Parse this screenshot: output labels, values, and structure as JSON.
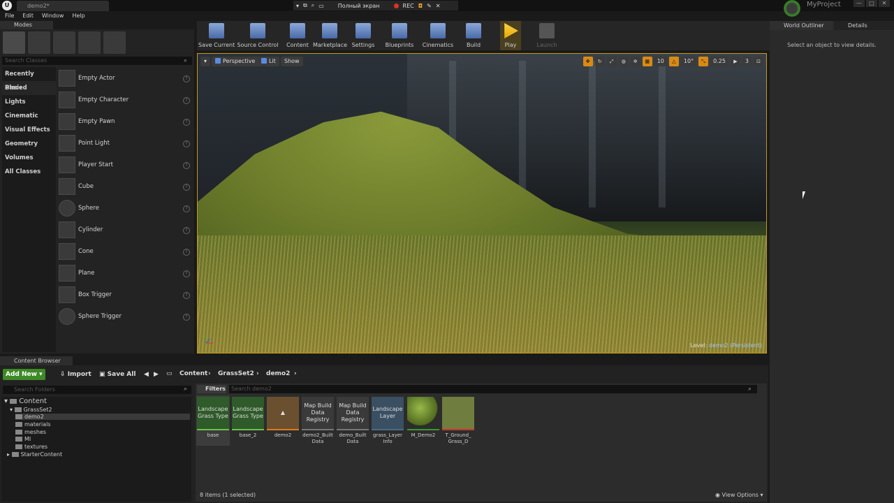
{
  "window": {
    "doc_tab": "demo2*",
    "project_name": "MyProject",
    "recorder": {
      "fullscreen_label": "Полный экран",
      "rec_label": "REC"
    }
  },
  "menu": [
    "File",
    "Edit",
    "Window",
    "Help"
  ],
  "modes": {
    "tab_label": "Modes",
    "search_placeholder": "Search Classes",
    "categories": [
      "Recently Placed",
      "Basic",
      "Lights",
      "Cinematic",
      "Visual Effects",
      "Geometry",
      "Volumes",
      "All Classes"
    ],
    "active_category": "Basic",
    "actors": [
      "Empty Actor",
      "Empty Character",
      "Empty Pawn",
      "Point Light",
      "Player Start",
      "Cube",
      "Sphere",
      "Cylinder",
      "Cone",
      "Plane",
      "Box Trigger",
      "Sphere Trigger"
    ]
  },
  "toolbar": {
    "buttons": [
      "Save Current",
      "Source Control",
      "Content",
      "Marketplace",
      "Settings",
      "Blueprints",
      "Cinematics",
      "Build",
      "Play",
      "Launch"
    ]
  },
  "viewport": {
    "perspective": "Perspective",
    "lit": "Lit",
    "show": "Show",
    "grid_snap": "10",
    "rot_snap": "10°",
    "scale_snap": "0.25",
    "camera_speed": "3",
    "level_label": "Level:",
    "level_value": "demo2 (Persistent)"
  },
  "right_panel": {
    "outliner_tab": "World Outliner",
    "details_tab": "Details",
    "details_message": "Select an object to view details."
  },
  "content_browser": {
    "tab_label": "Content Browser",
    "add_new": "Add New",
    "import": "Import",
    "save_all": "Save All",
    "breadcrumb": [
      "Content",
      "GrassSet2",
      "demo2"
    ],
    "folder_search_placeholder": "Search Folders",
    "asset_search_placeholder": "Search demo2",
    "filters_label": "Filters",
    "tree": [
      "Content",
      "GrassSet2",
      "demo2",
      "materials",
      "meshes",
      "MI",
      "textures",
      "StarterContent"
    ],
    "assets": [
      {
        "tile": "Landscape Grass Type",
        "name": "base",
        "color": "#2f5a2a"
      },
      {
        "tile": "Landscape Grass Type",
        "name": "base_2",
        "color": "#2f5a2a"
      },
      {
        "tile": "",
        "name": "demo2",
        "color": "#6b5030"
      },
      {
        "tile": "Map Build Data Registry",
        "name": "demo2_Built Data",
        "color": "#3a3a3a"
      },
      {
        "tile": "Map Build Data Registry",
        "name": "demo_Built Data",
        "color": "#3a3a3a"
      },
      {
        "tile": "Landscape Layer",
        "name": "grass_Layer Info",
        "color": "#3b4f63"
      },
      {
        "tile": "",
        "name": "M_Demo2",
        "color": "#5f7a2f"
      },
      {
        "tile": "",
        "name": "T_Ground_ Grass_D",
        "color": "#6f7e3e"
      }
    ],
    "items_count": "8 items (1 selected)",
    "view_options": "View Options"
  }
}
